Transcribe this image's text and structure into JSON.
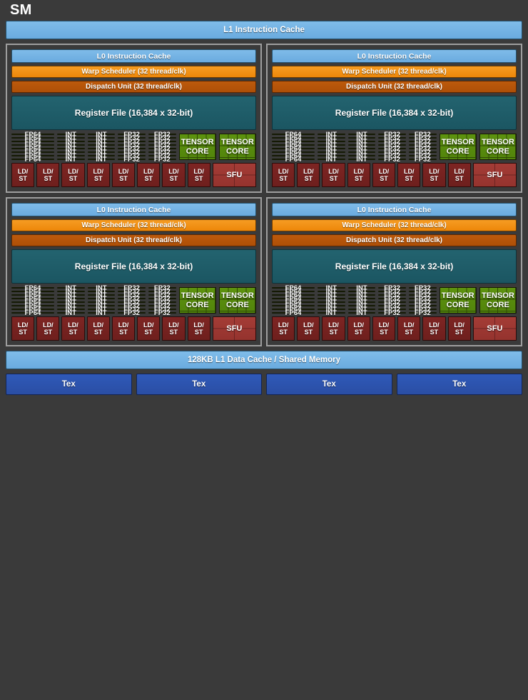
{
  "sm": {
    "title": "SM",
    "l1_instruction_cache": "L1 Instruction Cache",
    "l1_data_cache": "128KB L1 Data Cache / Shared Memory"
  },
  "colors": {
    "background": "#3a3a3a",
    "cache_blue": "#72b4e4",
    "warp_scheduler_orange": "#f0901a",
    "dispatch_orange": "#b8510a",
    "register_file_teal": "#1e5c68",
    "fp64_green": "#4a6b0a",
    "int_green": "#5e9b10",
    "fp32_green": "#76c90e",
    "tensor_green": "#58890d",
    "ldst_red": "#7b2220",
    "sfu_red": "#a03a34",
    "tex_blue": "#2a52ae",
    "quadrant_border": "#9e9e9e"
  },
  "processing_block": {
    "l0_instruction_cache": "L0 Instruction Cache",
    "warp_scheduler": "Warp Scheduler (32 thread/clk)",
    "dispatch_unit": "Dispatch Unit (32 thread/clk)",
    "register_file": "Register File (16,384 x 32-bit)",
    "core_columns": [
      {
        "type": "fp64",
        "label": "FP64",
        "count": 8,
        "columns": 1
      },
      {
        "type": "int",
        "label": "INT",
        "count": 8,
        "columns": 2
      },
      {
        "type": "fp32",
        "label": "FP32",
        "count": 8,
        "columns": 2
      },
      {
        "type": "tensor",
        "label": "TENSOR CORE",
        "count": 2,
        "columns": 2
      }
    ],
    "tensor_core_label_line1": "TENSOR",
    "tensor_core_label_line2": "CORE",
    "ldst_label_line1": "LD/",
    "ldst_label_line2": "ST",
    "ldst_count": 8,
    "sfu_label": "SFU",
    "sfu_count": 1,
    "rows_per_column": 8
  },
  "quadrant_count": 4,
  "tex_units": [
    {
      "label": "Tex"
    },
    {
      "label": "Tex"
    },
    {
      "label": "Tex"
    },
    {
      "label": "Tex"
    }
  ]
}
